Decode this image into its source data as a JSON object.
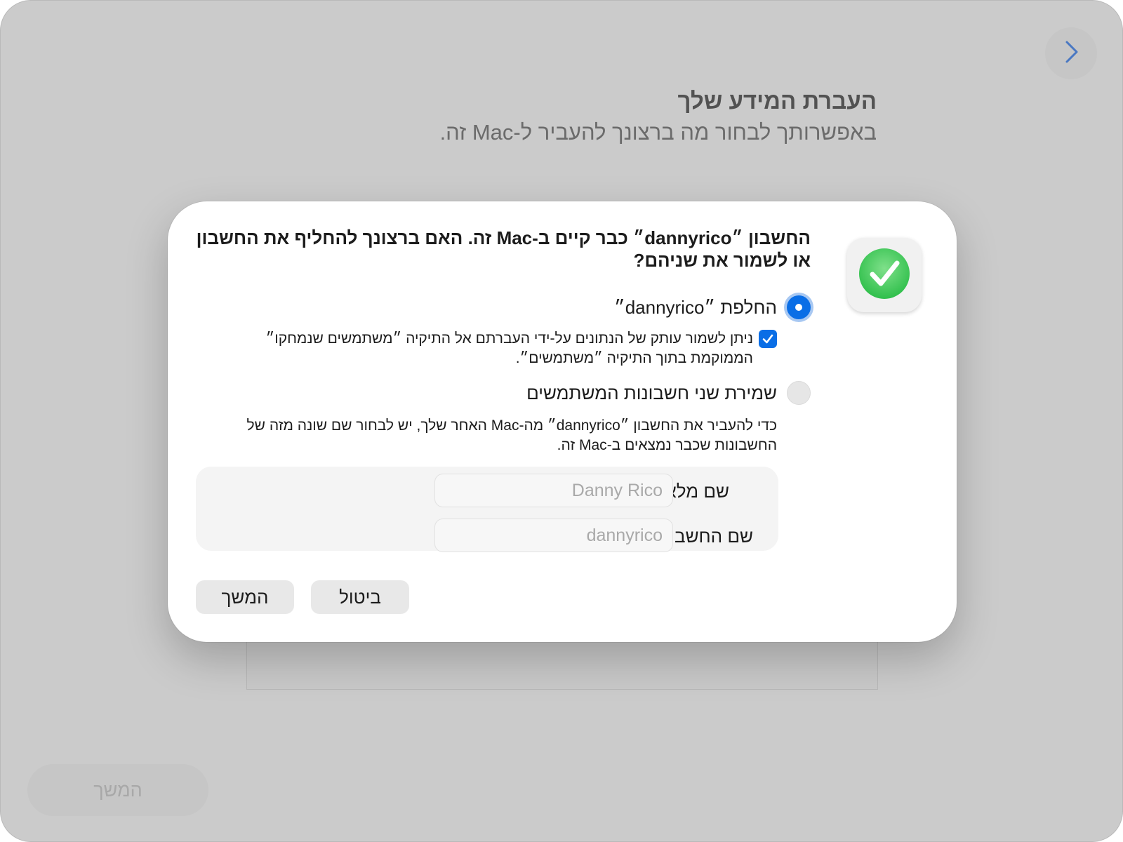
{
  "window": {
    "forward_icon": "chevron-right-icon"
  },
  "header": {
    "title": "העברת המידע שלך",
    "subtitle": "באפשרותך לבחור מה ברצונך להעביר ל-Mac זה."
  },
  "footer": {
    "continue_label": "המשך"
  },
  "dialog": {
    "icon": "green-checkmark-icon",
    "question": "החשבון ״dannyrico״ כבר קיים ב-Mac זה. האם ברצונך להחליף את החשבון או לשמור את שניהם?",
    "options": [
      {
        "label": "החלפת ״dannyrico״",
        "selected": true
      },
      {
        "label": "שמירת שני חשבונות המשתמשים",
        "selected": false
      }
    ],
    "checkbox": {
      "checked": true,
      "label": "ניתן לשמור עותק של הנתונים על-ידי העברתם אל התיקיה ״משתמשים שנמחקו״ הממוקמת בתוך התיקיה ״משתמשים״."
    },
    "explanation": "כדי להעביר את החשבון ״dannyrico״ מה-Mac האחר שלך, יש לבחור שם שונה מזה של החשבונות שכבר נמצאים ב-Mac זה.",
    "fields": {
      "full_name_label": "שם מלא:",
      "full_name_placeholder": "Danny Rico",
      "account_name_label": "שם החשבון:",
      "account_name_placeholder": "dannyrico"
    },
    "buttons": {
      "cancel": "ביטול",
      "continue": "המשך"
    }
  },
  "colors": {
    "accent": "#0a6ee6",
    "backdrop": "#cbcbcb",
    "success_green": "#34c759"
  }
}
